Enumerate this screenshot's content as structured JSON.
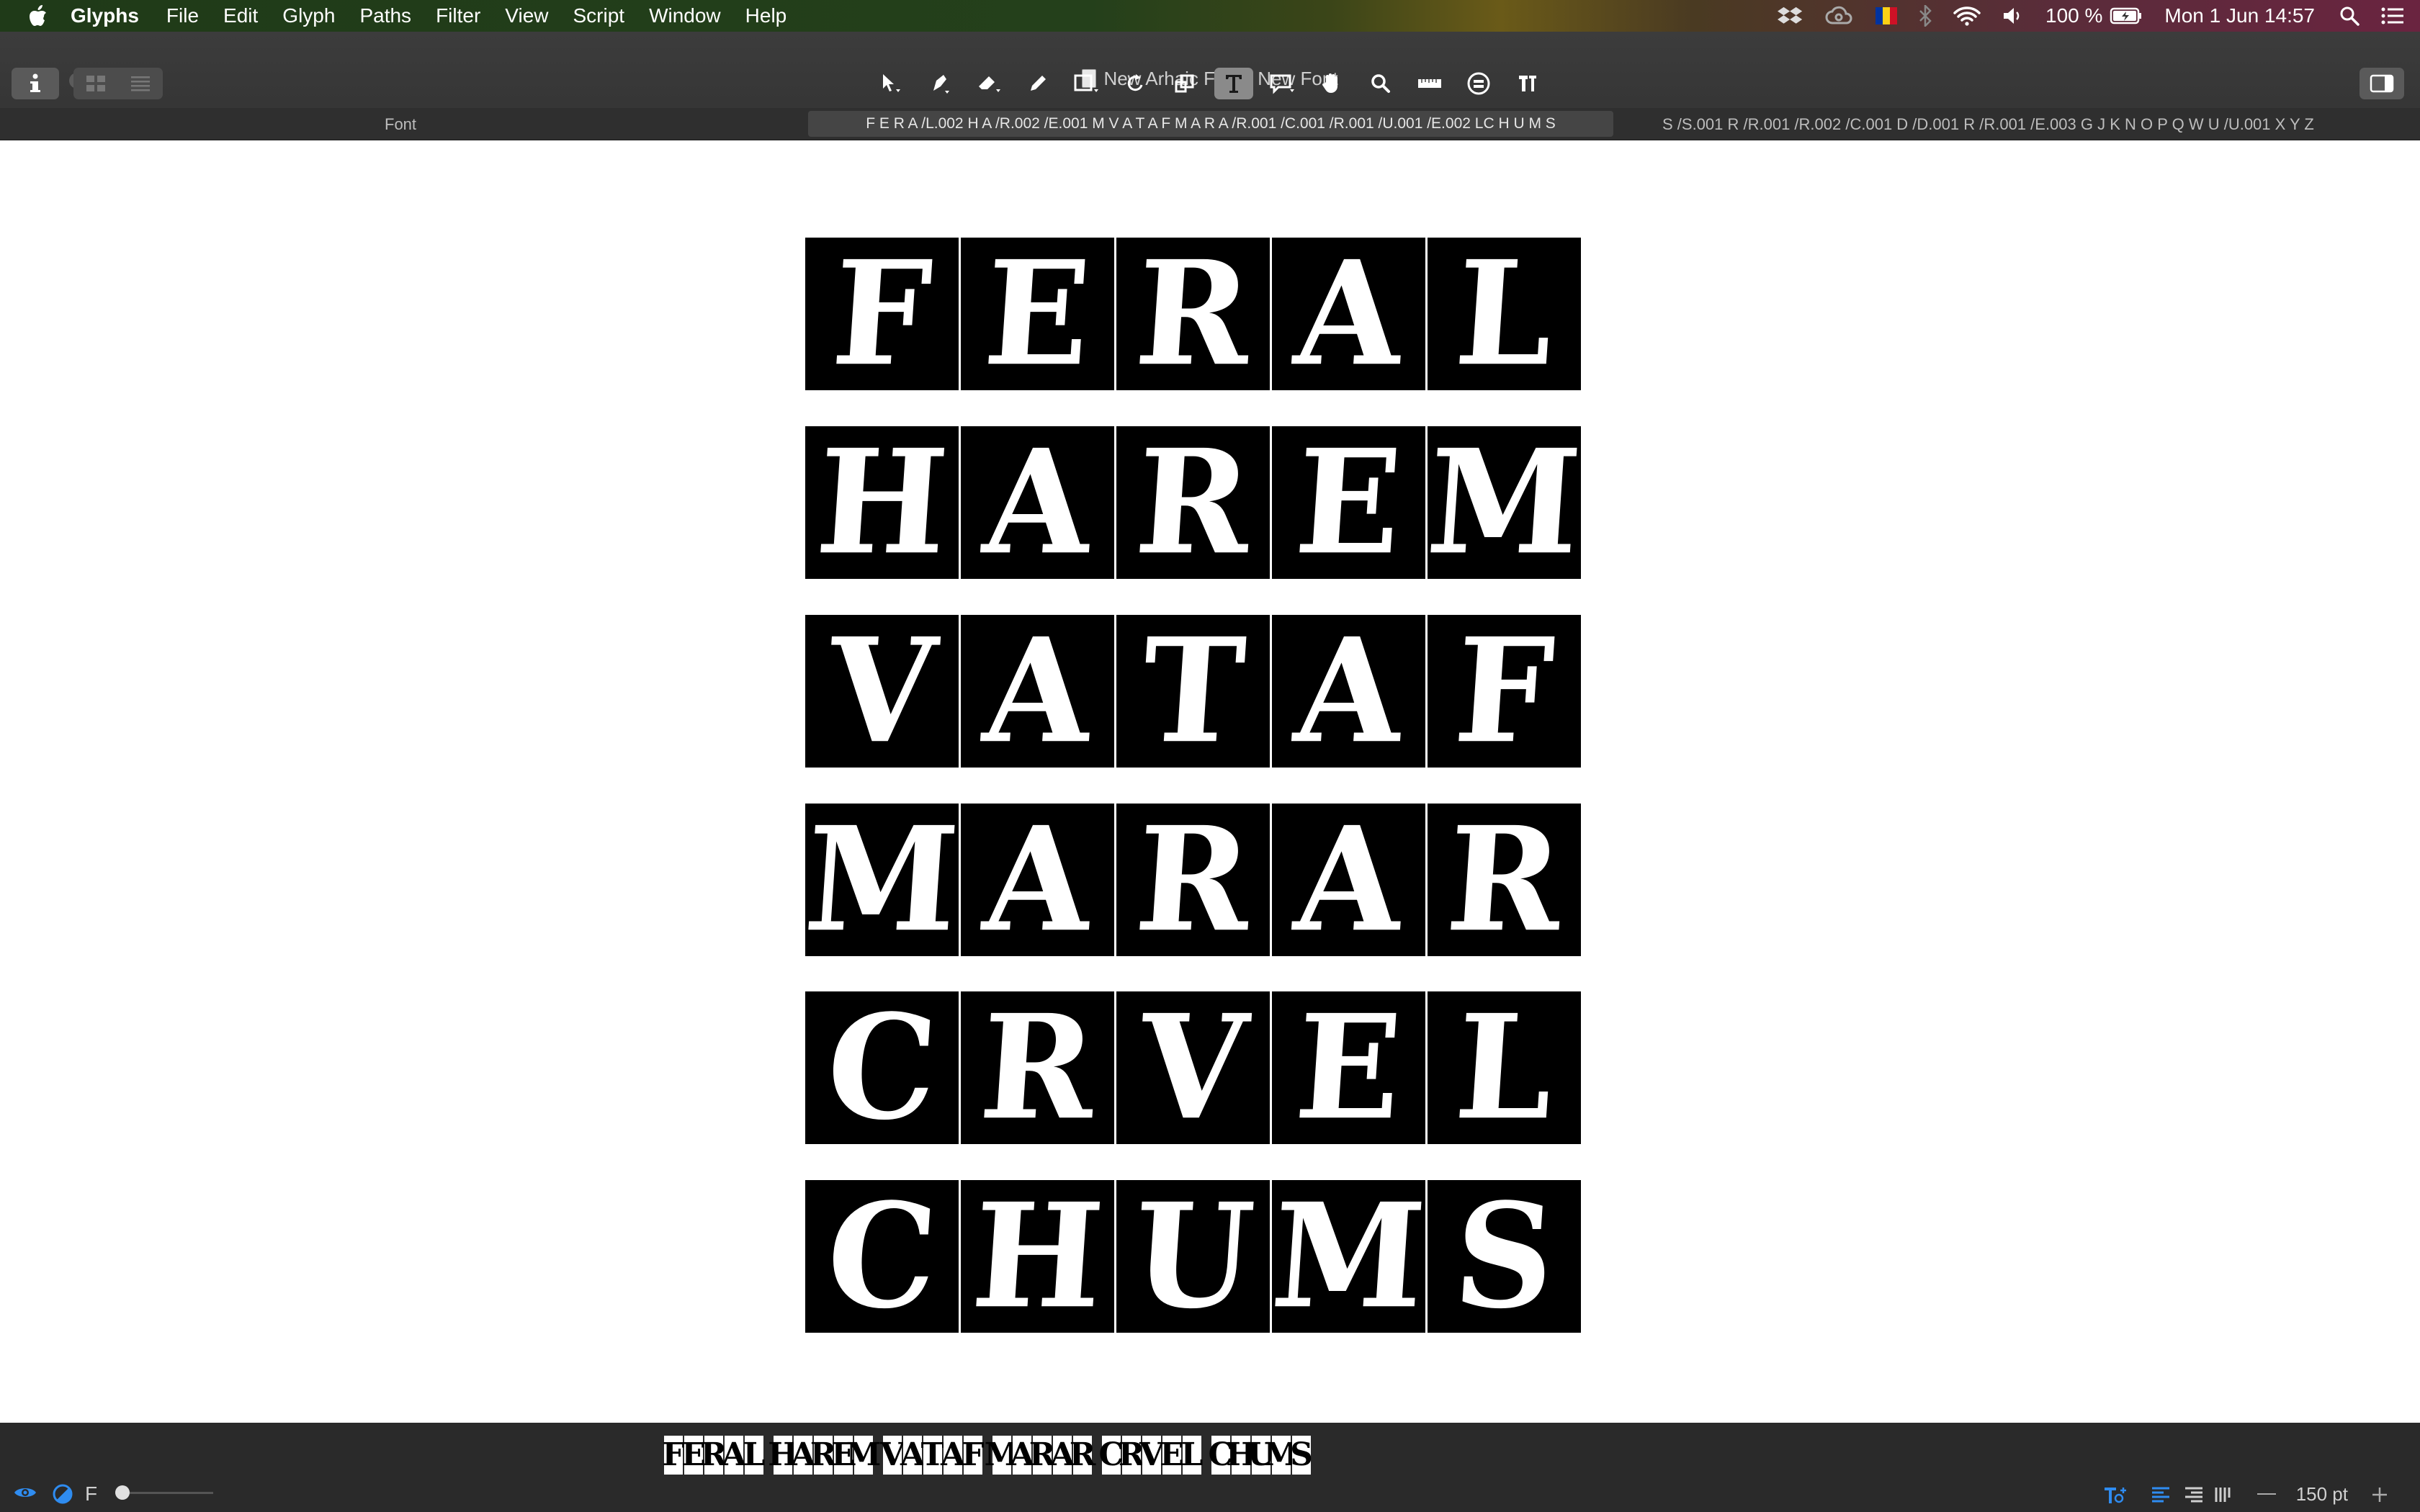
{
  "menubar": {
    "items": [
      "Glyphs",
      "File",
      "Edit",
      "Glyph",
      "Paths",
      "Filter",
      "View",
      "Script",
      "Window",
      "Help"
    ],
    "battery": "100 %",
    "clock": "Mon 1 Jun  14:57"
  },
  "window": {
    "title": "New Arhaic Font - New Font"
  },
  "tabs": {
    "font_label": "Font",
    "current_text": "F E R A /L.002  H A /R.002  /E.001  M V A T A F M A R A /R.001 /C.001  /R.001  /U.001  /E.002  LC H U M S",
    "glyph_list": "S /S.001  R /R.001  /R.002  /C.001  D /D.001  R /R.001  /E.003  G J K N O P Q W U /U.001  X Y Z"
  },
  "canvas": {
    "rows": [
      [
        "F",
        "E",
        "R",
        "A",
        "L"
      ],
      [
        "H",
        "A",
        "R",
        "E",
        "M"
      ],
      [
        "V",
        "A",
        "T",
        "A",
        "F"
      ],
      [
        "M",
        "A",
        "R",
        "A",
        "R"
      ],
      [
        "C",
        "R",
        "V",
        "E",
        "L"
      ],
      [
        "C",
        "H",
        "U",
        "M",
        "S"
      ]
    ]
  },
  "statusbar": {
    "layer_letter": "F",
    "zoom": "150 pt"
  },
  "colors": {
    "glyph_tile": "#000000",
    "glyph_fill": "#ffffff",
    "accent": "#2f8cf0"
  },
  "icons": [
    "apple-icon",
    "dropbox-icon",
    "creative-cloud-icon",
    "flag-icon",
    "bluetooth-icon",
    "wifi-icon",
    "volume-icon",
    "battery-icon",
    "spotlight-icon",
    "notification-center-icon",
    "info-icon",
    "grid-view-icon",
    "list-view-icon",
    "select-tool-icon",
    "pen-tool-icon",
    "eraser-tool-icon",
    "pencil-tool-icon",
    "rectangle-tool-icon",
    "rotate-tool-icon",
    "scale-tool-icon",
    "text-tool-icon",
    "annotation-tool-icon",
    "hand-tool-icon",
    "zoom-tool-icon",
    "measure-tool-icon",
    "components-icon",
    "kerning-tool-icon",
    "sidebar-toggle-icon",
    "eye-icon",
    "color-icon"
  ]
}
